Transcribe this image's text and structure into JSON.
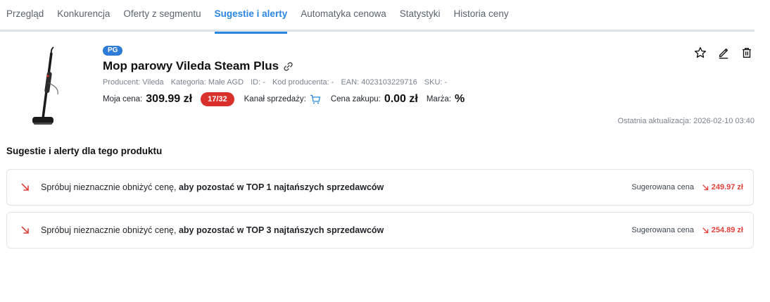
{
  "tabs": [
    {
      "label": "Przegląd"
    },
    {
      "label": "Konkurencja"
    },
    {
      "label": "Oferty z segmentu"
    },
    {
      "label": "Sugestie i alerty",
      "active": true
    },
    {
      "label": "Automatyka cenowa"
    },
    {
      "label": "Statystyki"
    },
    {
      "label": "Historia ceny"
    }
  ],
  "product": {
    "badge": "PG",
    "title": "Mop parowy Vileda Steam Plus",
    "producer": "Producent: Vileda",
    "category": "Kategoria: Małe AGD",
    "id": "ID: -",
    "producer_code": "Kod producenta: -",
    "ean": "EAN: 4023103229716",
    "sku": "SKU: -",
    "my_price_label": "Moja cena:",
    "my_price": "309.99 zł",
    "position": "17/32",
    "channel_label": "Kanał sprzedaży:",
    "purchase_label": "Cena zakupu:",
    "purchase_price": "0.00 zł",
    "margin_label": "Marża:",
    "margin_value": "%"
  },
  "last_update": "Ostatnia aktualizacja: 2026-02-10 03:40",
  "section_title": "Sugestie i alerty dla tego produktu",
  "alerts": [
    {
      "text": "Spróbuj nieznacznie obniżyć cenę,",
      "bold": "aby pozostać w TOP 1 najtańszych sprzedawców",
      "suggested_label": "Sugerowana cena",
      "suggested_price": "249.97 zł"
    },
    {
      "text": "Spróbuj nieznacznie obniżyć cenę,",
      "bold": "aby pozostać w TOP 3 najtańszych sprzedawców",
      "suggested_label": "Sugerowana cena",
      "suggested_price": "254.89 zł"
    }
  ],
  "colors": {
    "accent": "#2a86e0",
    "badge_blue": "#2f7bd8",
    "position_red": "#d9302c",
    "alert_red": "#e0413b"
  },
  "icons": {
    "link": "link-icon",
    "cart": "cart-icon",
    "star": "star-icon",
    "edit": "edit-icon",
    "delete": "trash-icon",
    "decrease": "arrow-down-right-icon"
  }
}
